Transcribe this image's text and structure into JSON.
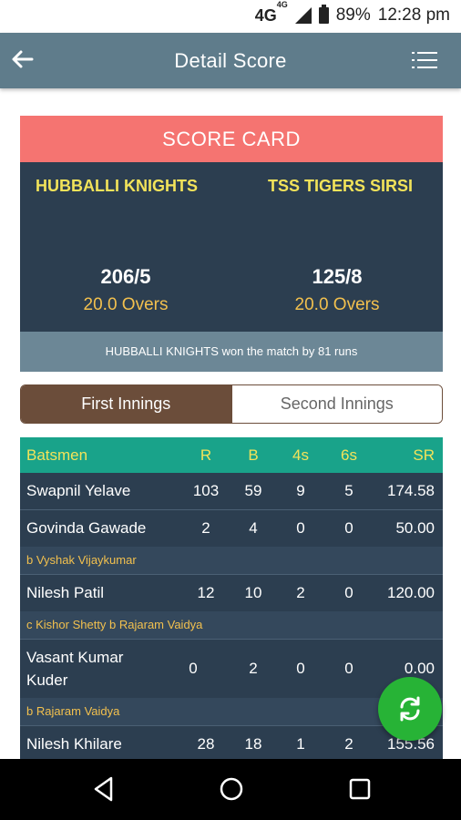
{
  "status_bar": {
    "network": "4G",
    "network_sup": "4G",
    "battery": "89%",
    "time": "12:28 pm"
  },
  "app_bar": {
    "title": "Detail Score"
  },
  "score_card": {
    "header": "SCORE CARD",
    "team_a": {
      "name": "HUBBALLI KNIGHTS",
      "score": "206/5",
      "overs": "20.0 Overs"
    },
    "team_b": {
      "name": "TSS TIGERS SIRSI",
      "score": "125/8",
      "overs": "20.0 Overs"
    },
    "result": "HUBBALLI KNIGHTS won the match by 81 runs"
  },
  "tabs": [
    {
      "label": "First Innings",
      "active": true
    },
    {
      "label": "Second Innings",
      "active": false
    }
  ],
  "batting_table": {
    "headers": [
      "Batsmen",
      "R",
      "B",
      "4s",
      "6s",
      "SR"
    ],
    "rows": [
      {
        "name": "Swapnil Yelave",
        "r": "103",
        "b": "59",
        "fours": "9",
        "sixes": "5",
        "sr": "174.58",
        "dismissal": ""
      },
      {
        "name": "Govinda Gawade",
        "r": "2",
        "b": "4",
        "fours": "0",
        "sixes": "0",
        "sr": "50.00",
        "dismissal": "b Vyshak Vijaykumar"
      },
      {
        "name": "Nilesh Patil",
        "r": "12",
        "b": "10",
        "fours": "2",
        "sixes": "0",
        "sr": "120.00",
        "dismissal": "c Kishor Shetty b Rajaram Vaidya"
      },
      {
        "name": "Vasant Kumar Kuder",
        "r": "0",
        "b": "2",
        "fours": "0",
        "sixes": "0",
        "sr": "0.00",
        "dismissal": "b Rajaram Vaidya"
      },
      {
        "name": "Nilesh Khilare",
        "r": "28",
        "b": "18",
        "fours": "1",
        "sixes": "2",
        "sr": "155.56",
        "dismissal": ""
      }
    ]
  },
  "colors": {
    "app_bar": "#5f7c8b",
    "score_header": "#f57471",
    "card_body": "#2c3e50",
    "team_name": "#f2e35a",
    "overs": "#f2c04e",
    "table_header": "#19a38a",
    "tab_active": "#6b4d3a",
    "fab": "#27b336"
  },
  "icons": {
    "back": "arrow-left-icon",
    "menu": "list-menu-icon",
    "fab": "refresh-icon"
  }
}
